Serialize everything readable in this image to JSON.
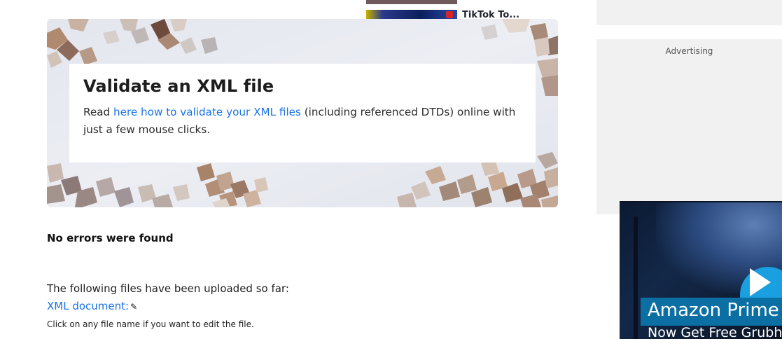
{
  "related": {
    "thumb_title": "TikTok To..."
  },
  "banner": {
    "title": "Validate an XML file",
    "text_prefix": "Read ",
    "link_text": "here how to validate your XML files",
    "text_suffix": " (including referenced DTDs) online with just a few mouse clicks."
  },
  "result": {
    "status": "No errors were found",
    "uploaded_label": "The following files have been uploaded so far:",
    "file_link": "XML document:",
    "hint": "Click on any file name if you want to edit the file."
  },
  "sidebar": {
    "ad_label": "Advertising"
  },
  "video_ad": {
    "line1": "Amazon Prime",
    "line2": "Now Get Free Grubh"
  }
}
